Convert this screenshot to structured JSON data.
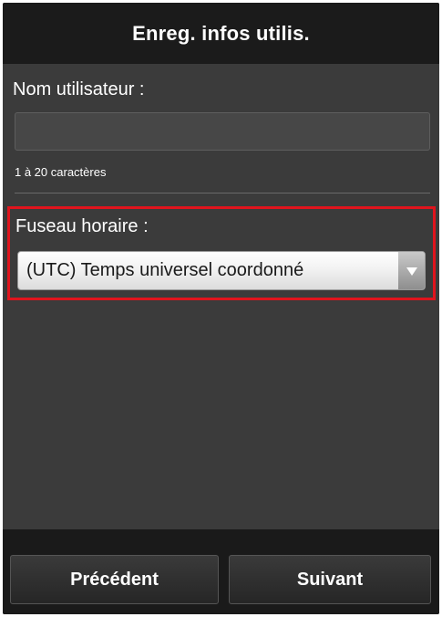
{
  "header": {
    "title": "Enreg. infos utilis."
  },
  "username": {
    "label": "Nom utilisateur :",
    "value": "",
    "hint": "1 à 20 caractères"
  },
  "timezone": {
    "label": "Fuseau horaire :",
    "selected": "(UTC) Temps universel coordonné",
    "arrow_icon": "triangle-down-icon",
    "highlight_color": "#e0141d"
  },
  "footer": {
    "prev_label": "Précédent",
    "next_label": "Suivant"
  },
  "colors": {
    "header_bg": "#1b1b1b",
    "content_bg": "#3b3b3b",
    "footer_bg": "#1a1a1a"
  }
}
